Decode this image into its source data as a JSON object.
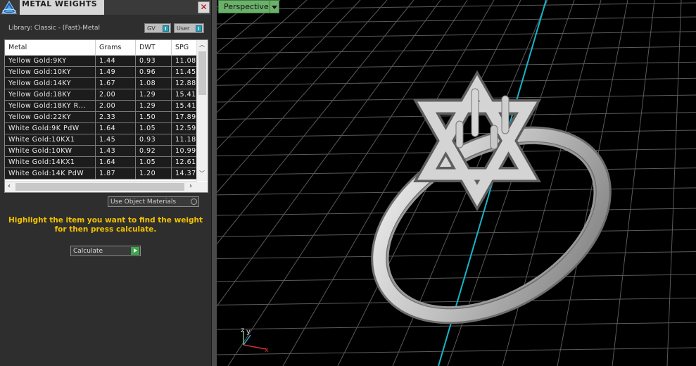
{
  "panel": {
    "title": "METAL WEIGHTS",
    "close_glyph": "✕",
    "library_label": "Library: Classic - (Fast)-Metal",
    "toggles": [
      {
        "label": "GV"
      },
      {
        "label": "User"
      }
    ],
    "table": {
      "columns": [
        "Metal",
        "Grams",
        "DWT",
        "SPG"
      ],
      "rows": [
        [
          "Yellow Gold:9KY",
          "1.44",
          "0.93",
          "11.08"
        ],
        [
          "Yellow Gold:10KY",
          "1.49",
          "0.96",
          "11.45"
        ],
        [
          "Yellow Gold:14KY",
          "1.67",
          "1.08",
          "12.88"
        ],
        [
          "Yellow Gold:18KY",
          "2.00",
          "1.29",
          "15.41"
        ],
        [
          "Yellow Gold:18KY R...",
          "2.00",
          "1.29",
          "15.41"
        ],
        [
          "Yellow Gold:22KY",
          "2.33",
          "1.50",
          "17.89"
        ],
        [
          "White Gold:9K PdW",
          "1.64",
          "1.05",
          "12.59"
        ],
        [
          "White Gold:10KX1",
          "1.45",
          "0.93",
          "11.18"
        ],
        [
          "White Gold:10KW",
          "1.43",
          "0.92",
          "10.99"
        ],
        [
          "White Gold:14KX1",
          "1.64",
          "1.05",
          "12.61"
        ],
        [
          "White Gold:14K PdW",
          "1.87",
          "1.20",
          "14.37"
        ]
      ]
    },
    "use_object_materials": "Use Object Materials",
    "hint": "Highlight the item you want to find the weight for then press calculate.",
    "calculate_label": "Calculate"
  },
  "viewport": {
    "view_label": "Perspective",
    "axis_labels": {
      "z": "z",
      "y": "y",
      "x": "x"
    }
  },
  "colors": {
    "hint_text": "#f2c200",
    "view_tag": "#6bb06b",
    "axis_line": "#18b4c8",
    "grid_line": "#5a5a5a",
    "ring_metal": "#c8c8c8"
  }
}
